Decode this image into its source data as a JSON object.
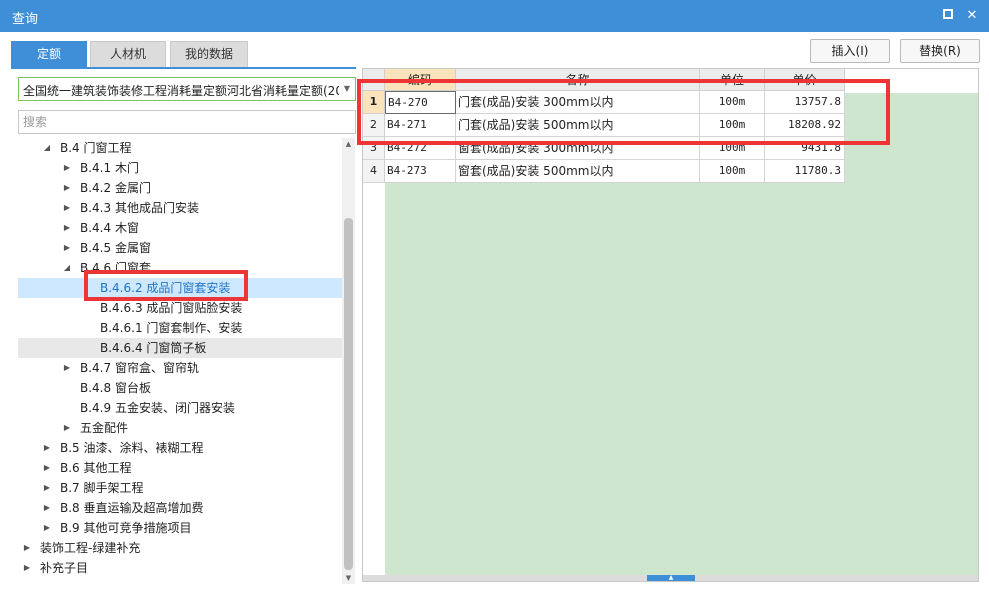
{
  "window": {
    "title": "查询"
  },
  "tabs": [
    "定额",
    "人材机",
    "我的数据"
  ],
  "buttons": {
    "insert": "插入(I)",
    "replace": "替换(R)"
  },
  "library": {
    "selected": "全国统一建筑装饰装修工程消耗量定额河北省消耗量定额(20"
  },
  "search": {
    "placeholder": "搜索"
  },
  "tree": [
    {
      "label": "B.4 门窗工程",
      "level": 1,
      "state": "expanded"
    },
    {
      "label": "B.4.1 木门",
      "level": 2,
      "state": "collapsed"
    },
    {
      "label": "B.4.2 金属门",
      "level": 2,
      "state": "collapsed"
    },
    {
      "label": "B.4.3 其他成品门安装",
      "level": 2,
      "state": "collapsed"
    },
    {
      "label": "B.4.4 木窗",
      "level": 2,
      "state": "collapsed"
    },
    {
      "label": "B.4.5 金属窗",
      "level": 2,
      "state": "collapsed"
    },
    {
      "label": "B.4.6 门窗套",
      "level": 2,
      "state": "expanded"
    },
    {
      "label": "B.4.6.2 成品门窗套安装",
      "level": 3,
      "state": "selected"
    },
    {
      "label": "B.4.6.3 成品门窗贴脸安装",
      "level": 3,
      "state": "leaf"
    },
    {
      "label": "B.4.6.1 门窗套制作、安装",
      "level": 3,
      "state": "leaf"
    },
    {
      "label": "B.4.6.4 门窗筒子板",
      "level": 3,
      "state": "hover"
    },
    {
      "label": "B.4.7 窗帘盒、窗帘轨",
      "level": 2,
      "state": "collapsed"
    },
    {
      "label": "B.4.8 窗台板",
      "level": 2,
      "state": "leaf"
    },
    {
      "label": "B.4.9 五金安装、闭门器安装",
      "level": 2,
      "state": "leaf"
    },
    {
      "label": "五金配件",
      "level": 2,
      "state": "collapsed"
    },
    {
      "label": "B.5 油漆、涂料、裱糊工程",
      "level": 1,
      "state": "collapsed"
    },
    {
      "label": "B.6 其他工程",
      "level": 1,
      "state": "collapsed"
    },
    {
      "label": "B.7 脚手架工程",
      "level": 1,
      "state": "collapsed"
    },
    {
      "label": "B.8 垂直运输及超高增加费",
      "level": 1,
      "state": "collapsed"
    },
    {
      "label": "B.9 其他可竞争措施项目",
      "level": 1,
      "state": "collapsed"
    },
    {
      "label": "装饰工程-绿建补充",
      "level": 0,
      "state": "collapsed"
    },
    {
      "label": "补充子目",
      "level": 0,
      "state": "collapsed"
    }
  ],
  "table": {
    "columns": [
      "编码",
      "名称",
      "单位",
      "单价"
    ],
    "rows": [
      {
        "num": "1",
        "code": "B4-270",
        "name": "门套(成品)安装 300mm以内",
        "unit": "100m",
        "price": "13757.8"
      },
      {
        "num": "2",
        "code": "B4-271",
        "name": "门套(成品)安装 500mm以内",
        "unit": "100m",
        "price": "18208.92"
      },
      {
        "num": "3",
        "code": "B4-272",
        "name": "窗套(成品)安装 300mm以内",
        "unit": "100m",
        "price": "9431.8"
      },
      {
        "num": "4",
        "code": "B4-273",
        "name": "窗套(成品)安装 500mm以内",
        "unit": "100m",
        "price": "11780.3"
      }
    ]
  },
  "colors": {
    "accent": "#3f8ed8",
    "highlight": "#ee3535",
    "grid_empty": "#cde6cd",
    "tree_selected": "#cde8ff"
  }
}
